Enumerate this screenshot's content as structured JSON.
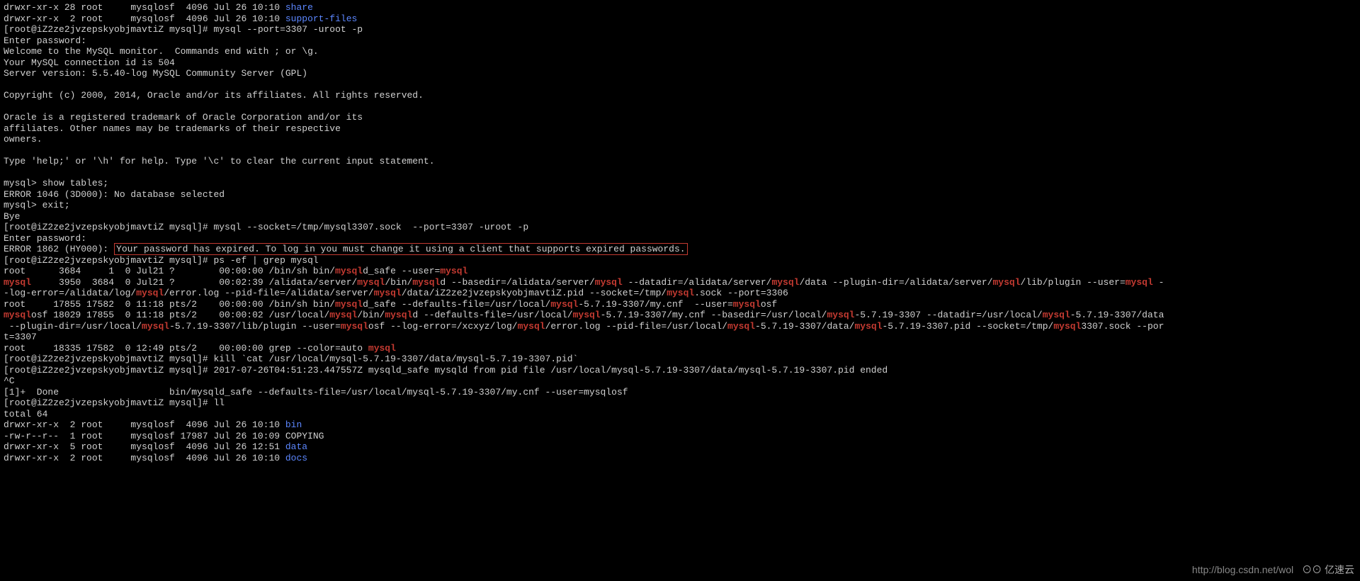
{
  "ls_head": [
    {
      "perm": "drwxr-xr-x 28 root     mysqlosf  4096 Jul 26 10:10 ",
      "name": "share"
    },
    {
      "perm": "drwxr-xr-x  2 root     mysqlosf  4096 Jul 26 10:10 ",
      "name": "support-files"
    }
  ],
  "prompt": "[root@iZ2ze2jvzepskyobjmavtiZ mysql]# ",
  "cmd_mysql1": "mysql --port=3307 -uroot -p",
  "enter_pw": "Enter password: ",
  "welcome": [
    "Welcome to the MySQL monitor.  Commands end with ; or \\g.",
    "Your MySQL connection id is 504",
    "Server version: 5.5.40-log MySQL Community Server (GPL)",
    "",
    "Copyright (c) 2000, 2014, Oracle and/or its affiliates. All rights reserved.",
    "",
    "Oracle is a registered trademark of Oracle Corporation and/or its",
    "affiliates. Other names may be trademarks of their respective",
    "owners.",
    "",
    "Type 'help;' or '\\h' for help. Type '\\c' to clear the current input statement.",
    ""
  ],
  "mysql_prompt": "mysql> ",
  "sql1": "show tables;",
  "err1": "ERROR 1046 (3D000): No database selected",
  "sql2": "exit;",
  "bye": "Bye",
  "cmd_mysql2": "mysql --socket=/tmp/mysql3307.sock  --port=3307 -uroot -p",
  "err_code": "ERROR 1862 (HY000): ",
  "err_msg": "Your password has expired. To log in you must change it using a client that supports expired passwords.",
  "cmd_ps": "ps -ef | grep mysql",
  "ps": {
    "l1a": "root      3684     1  0 Jul21 ?        00:00:00 /bin/sh bin/",
    "l1b": "mysql",
    "l1c": "d_safe --user=",
    "l1d": "mysql",
    "l2a": "mysql",
    "l2b": "     3950  3684  0 Jul21 ?        00:02:39 /alidata/server/",
    "l2c": "mysql",
    "l2d": "/bin/",
    "l2e": "mysql",
    "l2f": "d --basedir=/alidata/server/",
    "l2g": "mysql",
    "l2h": " --datadir=/alidata/server/",
    "l2i": "mysql",
    "l2j": "/data --plugin-dir=/alidata/server/",
    "l2k": "mysql",
    "l2l": "/lib/plugin --user=",
    "l2m": "mysql",
    "l2n": " -",
    "l3a": "-log-error=/alidata/log/",
    "l3b": "mysql",
    "l3c": "/error.log --pid-file=/alidata/server/",
    "l3d": "mysql",
    "l3e": "/data/iZ2ze2jvzepskyobjmavtiZ.pid --socket=/tmp/",
    "l3f": "mysql",
    "l3g": ".sock --port=3306",
    "l4a": "root     17855 17582  0 11:18 pts/2    00:00:00 /bin/sh bin/",
    "l4b": "mysql",
    "l4c": "d_safe --defaults-file=/usr/local/",
    "l4d": "mysql",
    "l4e": "-5.7.19-3307/my.cnf  --user=",
    "l4f": "mysql",
    "l4g": "osf",
    "l5a": "mysql",
    "l5b": "osf 18029 17855  0 11:18 pts/2    00:00:02 /usr/local/",
    "l5c": "mysql",
    "l5d": "/bin/",
    "l5e": "mysql",
    "l5f": "d --defaults-file=/usr/local/",
    "l5g": "mysql",
    "l5h": "-5.7.19-3307/my.cnf --basedir=/usr/local/",
    "l5i": "mysql",
    "l5j": "-5.7.19-3307 --datadir=/usr/local/",
    "l5k": "mysql",
    "l5l": "-5.7.19-3307/data",
    "l6a": " --plugin-dir=/usr/local/",
    "l6b": "mysql",
    "l6c": "-5.7.19-3307/lib/plugin --user=",
    "l6d": "mysql",
    "l6e": "osf --log-error=/xcxyz/log/",
    "l6f": "mysql",
    "l6g": "/error.log --pid-file=/usr/local/",
    "l6h": "mysql",
    "l6i": "-5.7.19-3307/data/",
    "l6j": "mysql",
    "l6k": "-5.7.19-3307.pid --socket=/tmp/",
    "l6l": "mysql",
    "l6m": "3307.sock --por",
    "l7": "t=3307",
    "l8a": "root     18335 17582  0 12:49 pts/2    00:00:00 grep --color=auto ",
    "l8b": "mysql"
  },
  "cmd_kill": "kill `cat /usr/local/mysql-5.7.19-3307/data/mysql-5.7.19-3307.pid`",
  "kill_out": "2017-07-26T04:51:23.447557Z mysqld_safe mysqld from pid file /usr/local/mysql-5.7.19-3307/data/mysql-5.7.19-3307.pid ended",
  "ctrlc": "^C",
  "done": "[1]+  Done                    bin/mysqld_safe --defaults-file=/usr/local/mysql-5.7.19-3307/my.cnf --user=mysqlosf",
  "cmd_ll": "ll",
  "total": "total 64",
  "ll": [
    {
      "p": "drwxr-xr-x  2 root     mysqlosf  4096 Jul 26 10:10 ",
      "n": "bin",
      "c": "blue"
    },
    {
      "p": "-rw-r--r--  1 root     mysqlosf 17987 Jul 26 10:09 COPYING",
      "n": "",
      "c": ""
    },
    {
      "p": "drwxr-xr-x  5 root     mysqlosf  4096 Jul 26 12:51 ",
      "n": "data",
      "c": "blue"
    },
    {
      "p": "drwxr-xr-x  2 root     mysqlosf  4096 Jul 26 10:10 ",
      "n": "docs",
      "c": "blue"
    }
  ],
  "wm_url": "http://blog.csdn.net/wol",
  "wm_logo": "⊙⊙ 亿速云"
}
